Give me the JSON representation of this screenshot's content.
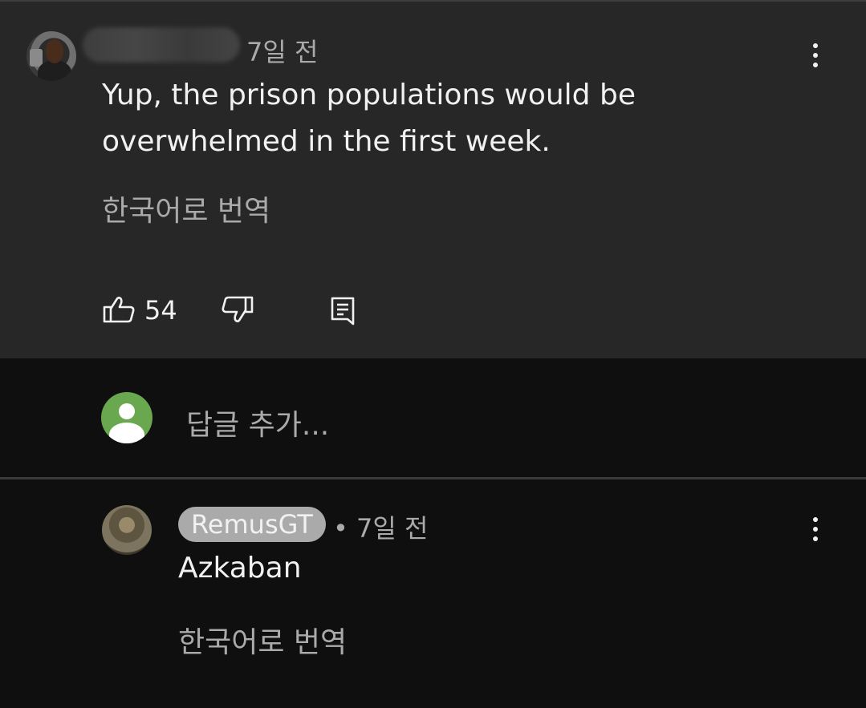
{
  "comment": {
    "time": "7일 전",
    "text": "Yup, the prison populations would be overwhelmed in the first week.",
    "translate": "한국어로 번역",
    "like_count": "54",
    "icons": {
      "more": "more-vert-icon",
      "like": "thumb-up-icon",
      "dislike": "thumb-down-icon",
      "reply": "reply-comment-icon"
    }
  },
  "reply_box": {
    "placeholder": "답글 추가...",
    "avatar_color": "#6aa84f"
  },
  "reply": {
    "author": "RemusGT",
    "time": "• 7일 전",
    "text": "Azkaban",
    "translate": "한국어로 번역"
  },
  "colors": {
    "background": "#0f0f0f",
    "comment_background": "#272727",
    "primary_text": "#f1f1f1",
    "secondary_text": "#aaaaaa"
  }
}
